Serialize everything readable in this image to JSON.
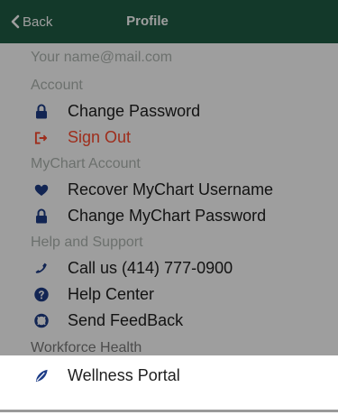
{
  "header": {
    "back_label": "Back",
    "title": "Profile"
  },
  "account_hint": "Your name@mail.com",
  "sections": {
    "account": "Account",
    "mychart": "MyChart Account",
    "help": "Help and Support",
    "workforce": "Workforce Health"
  },
  "items": {
    "change_password": "Change Password",
    "sign_out": "Sign Out",
    "recover_username": "Recover MyChart Username",
    "change_mychart_password": "Change MyChart Password",
    "call_us": "Call us (414) 777-0900",
    "help_center": "Help Center",
    "send_feedback": "Send FeedBack",
    "wellness_portal": "Wellness Portal"
  },
  "colors": {
    "header": "#1f5c44",
    "accent": "#1d3c87",
    "danger": "#ff4a2e"
  }
}
